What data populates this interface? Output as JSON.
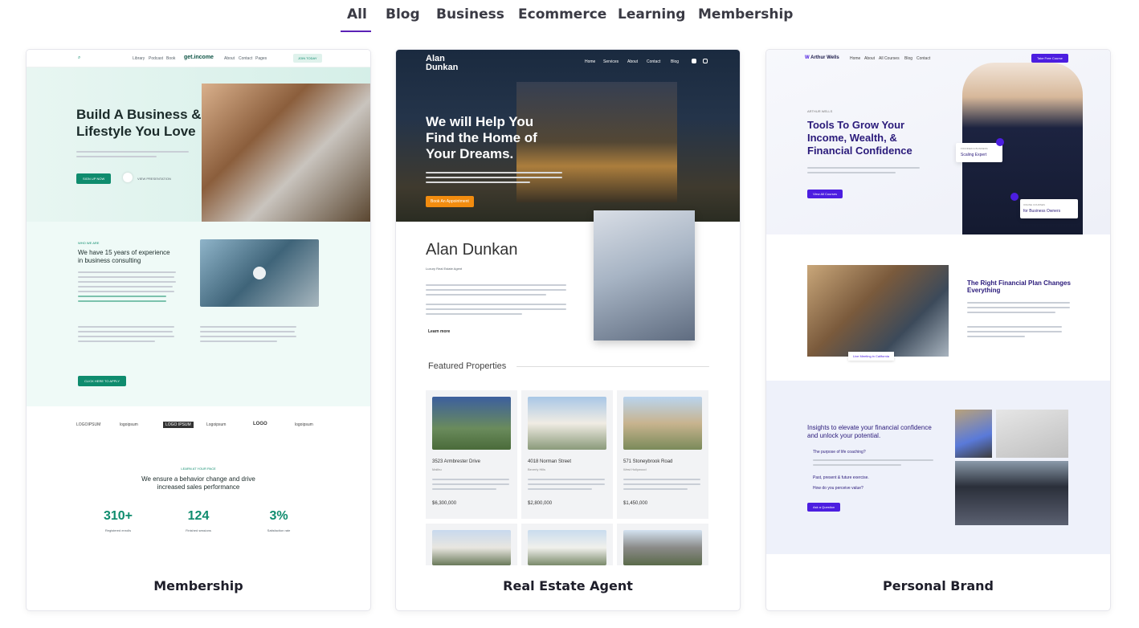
{
  "tabs": [
    "All",
    "Blog",
    "Business",
    "Ecommerce",
    "Learning",
    "Membership"
  ],
  "active_tab": "All",
  "accent_color": "#5b21b6",
  "cards": [
    {
      "title": "Membership",
      "preview": {
        "nav_links": [
          "Library",
          "Podcast",
          "Book"
        ],
        "logo": "get.income",
        "nav_links_right": [
          "About",
          "Contact",
          "Pages"
        ],
        "nav_button": "JOIN TODAY",
        "hero_heading_1": "Build A Business &",
        "hero_heading_2": "Lifestyle You Love",
        "hero_button": "SIGN UP NOW",
        "hero_link": "VIEW PRESENTATION",
        "who_label": "WHO WE ARE",
        "exp_heading_1": "We have 15 years of experience",
        "exp_heading_2": "in business consulting",
        "apply_button": "CLICK HERE TO APPLY",
        "logos": [
          "LOGOIPSUM",
          "logoipsum",
          "LOGO IPSUM",
          "Logoipsum",
          "LOGO",
          "logoipsum"
        ],
        "pace_label": "LEARN AT YOUR PACE",
        "pace_heading_1": "We ensure a behavior change and drive",
        "pace_heading_2": "increased sales performance",
        "stats": [
          {
            "value": "310+",
            "label": "Registered enrolls"
          },
          {
            "value": "124",
            "label": "Finished sessions"
          },
          {
            "value": "3%",
            "label": "Satisfaction rate"
          }
        ]
      }
    },
    {
      "title": "Real Estate Agent",
      "preview": {
        "logo_1": "Alan",
        "logo_2": "Dunkan",
        "nav_links": [
          "Home",
          "Services",
          "About",
          "Contact",
          "Blog"
        ],
        "hero_heading_1": "We will Help You",
        "hero_heading_2": "Find the Home of",
        "hero_heading_3": "Your Dreams.",
        "hero_button": "Book An Appointment",
        "agent_name": "Alan Dunkan",
        "agent_role": "Luxury Real Estate Agent",
        "learn_more": "Learn more",
        "featured_heading": "Featured Properties",
        "properties": [
          {
            "address": "3523 Armbrester Drive",
            "city": "Malibu",
            "price": "$6,300,000"
          },
          {
            "address": "4018 Norman Street",
            "city": "Beverly Hills",
            "price": "$2,800,000"
          },
          {
            "address": "571 Stoneybrook Road",
            "city": "West Hollywood",
            "price": "$1,450,000"
          }
        ]
      }
    },
    {
      "title": "Personal Brand",
      "preview": {
        "logo": "Arthur Wells",
        "nav_links": [
          "Home",
          "About",
          "All Courses",
          "Blog",
          "Contact"
        ],
        "nav_button": "Take Free Course",
        "eyebrow": "ARTHUR WELLS",
        "hero_heading_1": "Tools To Grow Your",
        "hero_heading_2": "Income, Wealth, &",
        "hero_heading_3": "Financial Confidence",
        "hero_button": "View All Courses",
        "badge_1_top": "FOUNDER & BUSINESS",
        "badge_1_bottom": "Scaling Expert",
        "badge_2_top": "ONLINE COURSES",
        "badge_2_bottom": "for Business Owners",
        "plan_heading_1": "The Right Financial Plan Changes",
        "plan_heading_2": "Everything",
        "live_meeting": "Live Meeting in California",
        "insights_heading_1": "Insights to elevate your financial confidence",
        "insights_heading_2": "and unlock your potential.",
        "bullets": [
          "The purpose of life coaching?",
          "Past, present & future exercise.",
          "How do you perceive value?"
        ],
        "question_button": "Ask a Question"
      }
    }
  ]
}
